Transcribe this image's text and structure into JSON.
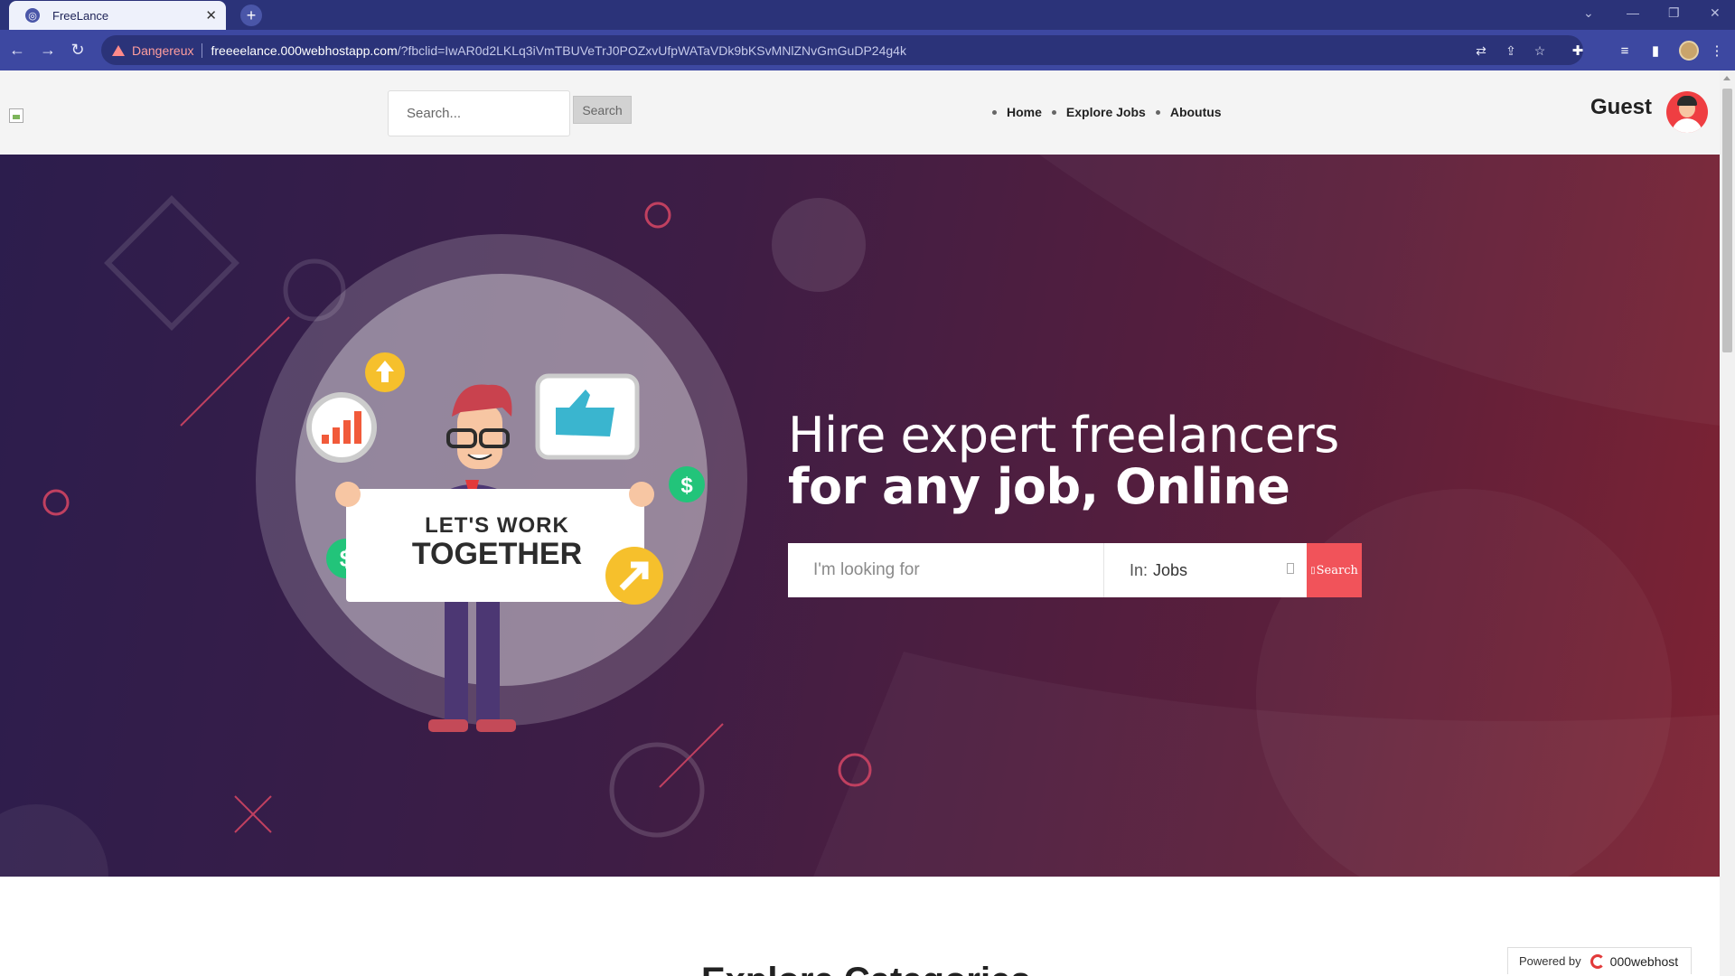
{
  "browser": {
    "tab_title": "FreeLance",
    "tab_close": "✕",
    "new_tab": "+",
    "security_label": "Dangereux",
    "url_host": "freeeelance.000webhostapp.com",
    "url_rest": "/?fbclid=IwAR0d2LKLq3iVmTBUVeTrJ0POZxvUfpWATaVDk9bKSvMNlZNvGmGuDP24g4k",
    "icons": [
      "back-icon",
      "forward-icon",
      "reload-icon",
      "warning-icon",
      "translate-icon",
      "share-icon",
      "bookmark-star-icon",
      "extensions-icon",
      "media-icon",
      "side-panel-icon",
      "profile-avatar",
      "menu-icon"
    ]
  },
  "header": {
    "search_placeholder": "Search...",
    "search_button": "Search",
    "nav": [
      "Home",
      "Explore Jobs",
      "Aboutus"
    ],
    "user_name": "Guest"
  },
  "hero": {
    "title_line1": "Hire expert freelancers",
    "title_line2": "for any job, Online",
    "search_placeholder": "I'm looking for",
    "category_prefix": "In:",
    "category_value": "Jobs",
    "search_button": "Search",
    "illustration_text_line1": "LET'S WORK",
    "illustration_text_line2": "TOGETHER"
  },
  "footer_partial": {
    "section_heading": "Explore Categories",
    "powered_by": "Powered by",
    "powered_brand": "000webhost"
  },
  "colors": {
    "browser_frame": "#2b3379",
    "accent": "#f1535a",
    "hero_start": "#2c1d4d",
    "hero_end": "#7e2333"
  }
}
